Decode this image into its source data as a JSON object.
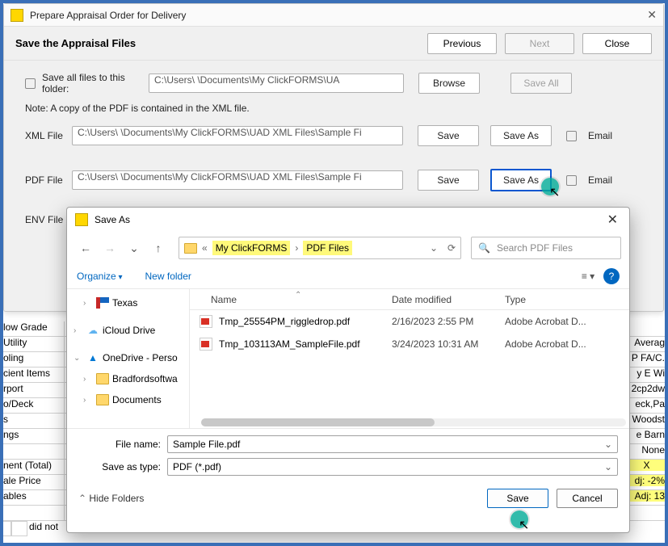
{
  "parent": {
    "title": "Prepare Appraisal Order for Delivery",
    "subtitle": "Save the Appraisal Files",
    "prev": "Previous",
    "next": "Next",
    "close": "Close",
    "save_all_label": "Save all files to this folder:",
    "save_all_path": "C:\\Users\\               \\Documents\\My ClickFORMS\\UA",
    "browse": "Browse",
    "save_all_btn": "Save All",
    "note": "Note: A copy of the PDF is contained in the XML file.",
    "xml": {
      "label": "XML File",
      "path": "C:\\Users\\               \\Documents\\My ClickFORMS\\UAD XML Files\\Sample Fi",
      "save": "Save",
      "saveas": "Save As",
      "email": "Email"
    },
    "pdf": {
      "label": "PDF File",
      "path": "C:\\Users\\               \\Documents\\My ClickFORMS\\UAD XML Files\\Sample Fi",
      "save": "Save",
      "saveas": "Save As",
      "email": "Email"
    },
    "env": {
      "label": "ENV File"
    }
  },
  "saveDialog": {
    "title": "Save As",
    "crumb_root": "My ClickFORMS",
    "crumb_leaf": "PDF Files",
    "search_placeholder": "Search PDF Files",
    "organize": "Organize",
    "new_folder": "New folder",
    "columns": {
      "name": "Name",
      "date": "Date modified",
      "type": "Type"
    },
    "tree": {
      "texas": "Texas",
      "icloud": "iCloud Drive",
      "onedrive": "OneDrive - Perso",
      "bradford": "Bradfordsoftwa",
      "documents": "Documents"
    },
    "rows": [
      {
        "name": "Tmp_25554PM_riggledrop.pdf",
        "date": "2/16/2023 2:55 PM",
        "type": "Adobe Acrobat D..."
      },
      {
        "name": "Tmp_103113AM_SampleFile.pdf",
        "date": "3/24/2023 10:31 AM",
        "type": "Adobe Acrobat D..."
      }
    ],
    "file_name_label": "File name:",
    "file_name_value": "Sample File.pdf",
    "save_type_label": "Save as type:",
    "save_type_value": "PDF (*.pdf)",
    "hide_folders": "Hide Folders",
    "save": "Save",
    "cancel": "Cancel"
  },
  "bg": {
    "left": [
      "low Grade",
      "Utility",
      "oling",
      "cient Items",
      "rport",
      "o/Deck",
      "s",
      "ngs",
      "",
      "nent (Total)",
      "ale Price",
      "ables",
      ""
    ],
    "right": [
      "",
      "Averag",
      "P FA/C.",
      "y E Wi",
      "2cp2dw",
      "eck,Pa",
      "Woodst",
      "e Barn",
      "None",
      "X",
      "dj: -2%",
      "Adj: 13"
    ],
    "last": "did not"
  }
}
